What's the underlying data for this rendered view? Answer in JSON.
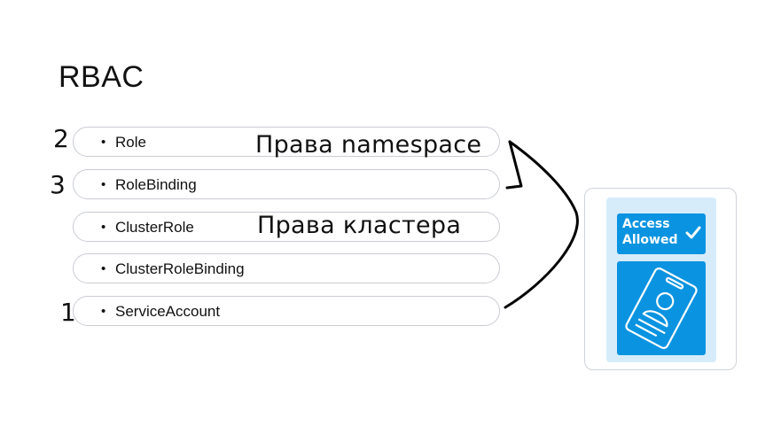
{
  "title": "RBAC",
  "items": [
    {
      "label": "Role",
      "number": "2"
    },
    {
      "label": "RoleBinding",
      "number": "3"
    },
    {
      "label": "ClusterRole",
      "number": ""
    },
    {
      "label": "ClusterRoleBinding",
      "number": ""
    },
    {
      "label": "ServiceAccount",
      "number": "1"
    }
  ],
  "bullet": "•",
  "notes": {
    "namespace_rights": "Права namespace",
    "cluster_rights": "Права кластера"
  },
  "access_card": {
    "line1": "Access",
    "line2": "Allowed",
    "icons": [
      "check-icon",
      "id-card-icon"
    ],
    "colors": {
      "badge": "#0a93e0",
      "panel": "#d6ecfb"
    }
  }
}
